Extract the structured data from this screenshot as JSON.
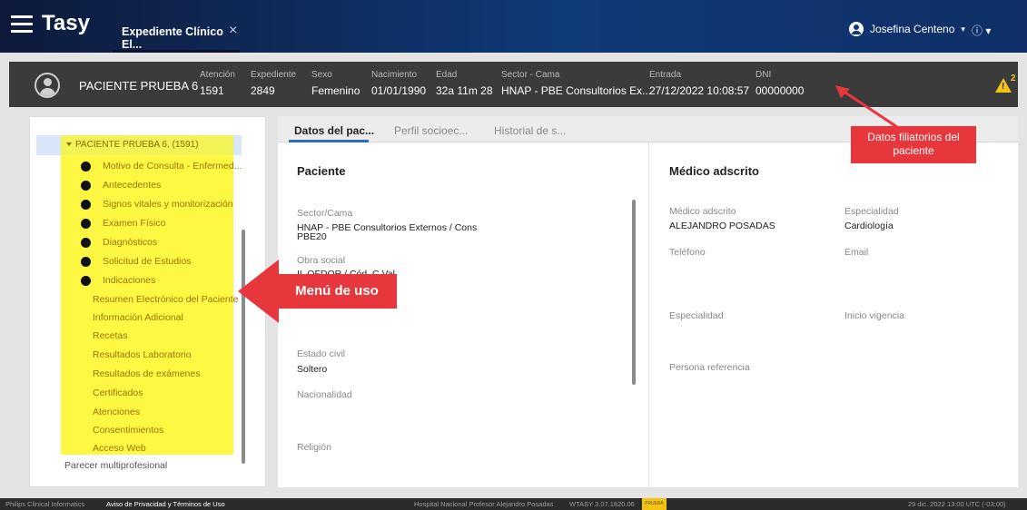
{
  "header": {
    "app_title": "Tasy",
    "tab_label": "Expediente Clínico El...",
    "tab_close": "×",
    "user_name": "Josefina Centeno",
    "user_caret": "▾",
    "info_label": "ⓘ ▾"
  },
  "patient": {
    "name": "PACIENTE PRUEBA 6",
    "fields": [
      {
        "label": "Atención",
        "value": "1591"
      },
      {
        "label": "Expediente",
        "value": "2849"
      },
      {
        "label": "Sexo",
        "value": "Femenino"
      },
      {
        "label": "Nacimiento",
        "value": "01/01/1990"
      },
      {
        "label": "Edad",
        "value": "32a 11m 28"
      },
      {
        "label": "Sector - Cama",
        "value": "HNAP - PBE Consultorios Ex..."
      },
      {
        "label": "Entrada",
        "value": "27/12/2022 10:08:57"
      },
      {
        "label": "DNI",
        "value": "00000000"
      }
    ],
    "alert_count": "2",
    "alert_mark": "!"
  },
  "menu": {
    "root": "PACIENTE PRUEBA 6, (1591)",
    "top_items": [
      "Motivo de Consulta - Enfermed...",
      "Antecedentes",
      "Signos vitales y monitorización",
      "Examen Físico",
      "Diagnósticos",
      "Solicitud de Estudios",
      "Indicaciones"
    ],
    "sub_items": [
      "Resumen Electrónico del Paciente",
      "Información Adicional",
      "Recetas",
      "Resultados Laboratorio",
      "Resultados de exámenes",
      "Certificados",
      "Atenciones",
      "Consentimientos",
      "Acceso Web"
    ],
    "last_item": "Parecer multiprofesional"
  },
  "tabs": [
    "Datos del pac...",
    "Perfil socioec...",
    "Historial de s..."
  ],
  "left_section": {
    "title": "Paciente",
    "sector_label": "Sector/Cama",
    "sector_value": "HNAP - PBE Consultorios Externos / Cons",
    "sector_value2": "PBE20",
    "obra_label": "Obra social",
    "obra_value": "IL OFDOR / Cód. C.Val",
    "civil_label": "Estado civil",
    "civil_value": "Soltero",
    "nac_label": "Nacionalidad",
    "religion_label": "Religión"
  },
  "right_section": {
    "title": "Médico adscrito",
    "medico_label": "Médico adscrito",
    "medico_value": "ALEJANDRO POSADAS",
    "esp_label": "Especialidad",
    "esp_value": "Cardiología",
    "tel_label": "Teléfono",
    "email_label": "Email",
    "esp2_label": "Especialidad",
    "inicio_label": "Inicio vigencia",
    "persona_label": "Persona referencia"
  },
  "callouts": {
    "menu": "Menú de uso",
    "datos_line1": "Datos filiatorios del",
    "datos_line2": "paciente"
  },
  "footer": {
    "left": "Philips Clinical Informatics",
    "privacy": "Aviso de Privacidad y Términos de Uso",
    "hospital": "Hospital Nacional Profesor Alejandro Posadas",
    "version": "WTASY 3.07.1820.06",
    "badge": "PRUEBA",
    "datetime": "29 dic. 2022  13:00  UTC (-03:00)"
  },
  "colors": {
    "callout_red": "#e8363d",
    "highlight_yellow": "#fff842",
    "tab_accent": "#2a6ec6",
    "alert_yellow": "#f3c316"
  }
}
